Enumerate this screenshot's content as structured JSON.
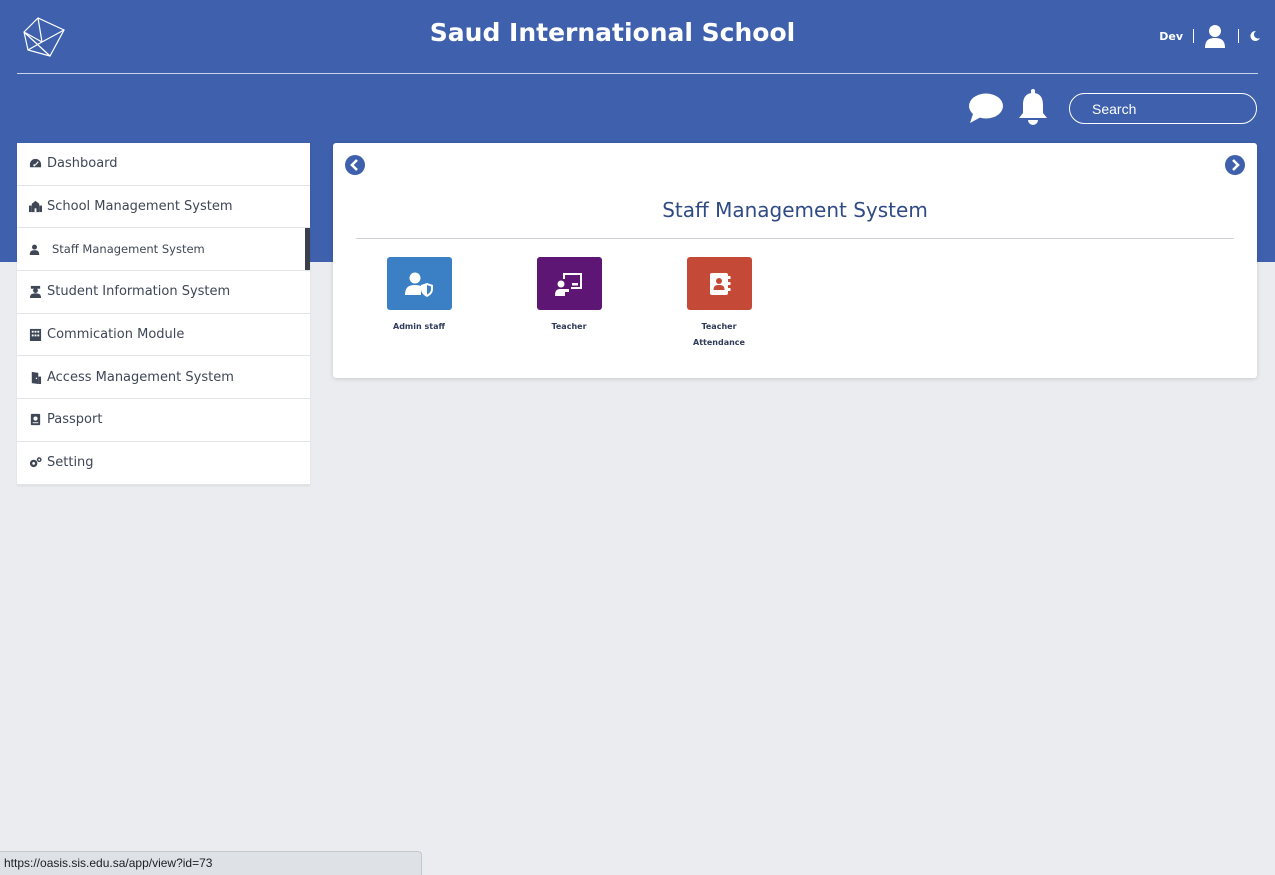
{
  "header": {
    "title": "Saud International School",
    "user_name": "Dev",
    "search_placeholder": "Search",
    "logo_icon": "cube-logo-icon",
    "icons": [
      "user-icon",
      "moon-icon",
      "chat-icon",
      "bell-icon"
    ],
    "background_color": "#3e60ad"
  },
  "sidebar": {
    "items": [
      {
        "label": "Dashboard",
        "icon": "tachometer-icon",
        "active": false
      },
      {
        "label": "School Management System",
        "icon": "school-icon",
        "active": false
      },
      {
        "label": "Staff Management System",
        "icon": "user-tie-icon",
        "active": true
      },
      {
        "label": "Student Information System",
        "icon": "graduate-icon",
        "active": false
      },
      {
        "label": "Commication Module",
        "icon": "building-icon",
        "active": false
      },
      {
        "label": "Access Management System",
        "icon": "door-icon",
        "active": false
      },
      {
        "label": "Passport",
        "icon": "passport-icon",
        "active": false
      },
      {
        "label": "Setting",
        "icon": "gears-icon",
        "active": false
      }
    ]
  },
  "main": {
    "title": "Staff Management System",
    "modules": [
      {
        "label": "Admin staff",
        "icon": "user-shield-icon",
        "color": "#3b7fc4"
      },
      {
        "label": "Teacher",
        "icon": "chalkboard-teacher-icon",
        "color": "#5e1675"
      },
      {
        "label_line1": "Teacher",
        "label_line2": "Attendance",
        "icon": "address-book-icon",
        "color": "#c44a37"
      }
    ]
  },
  "status_bar": {
    "url": "https://oasis.sis.edu.sa/app/view?id=73"
  }
}
